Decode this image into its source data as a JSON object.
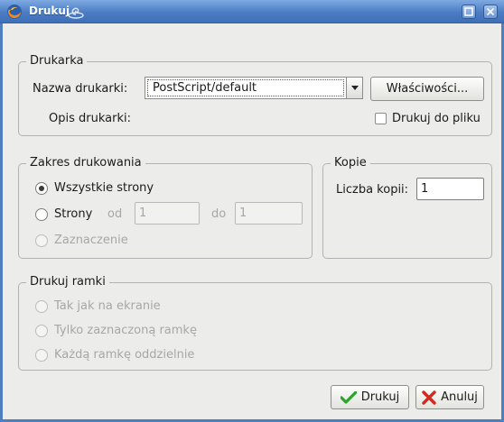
{
  "window": {
    "title": "Drukuj"
  },
  "printer": {
    "group_title": "Drukarka",
    "name_label": "Nazwa drukarki:",
    "selected_printer": "PostScript/default",
    "properties_button": "Właściwości...",
    "description_label": "Opis drukarki:",
    "print_to_file_label": "Drukuj do pliku",
    "print_to_file_checked": false
  },
  "range": {
    "group_title": "Zakres drukowania",
    "all_pages": "Wszystkie strony",
    "pages": "Strony",
    "from_label": "od",
    "from_value": "1",
    "to_label": "do",
    "to_value": "1",
    "selection": "Zaznaczenie"
  },
  "copies": {
    "group_title": "Kopie",
    "count_label": "Liczba kopii:",
    "count_value": "1"
  },
  "frames": {
    "group_title": "Drukuj ramki",
    "as_on_screen": "Tak jak na ekranie",
    "selected_frame": "Tylko zaznaczoną ramkę",
    "each_frame": "Każdą ramkę oddzielnie"
  },
  "actions": {
    "print_button": "Drukuj",
    "cancel_button": "Anuluj"
  },
  "colors": {
    "titlebar": "#4b7cc4",
    "print_icon": "#2aa52a",
    "cancel_icon": "#d22a1e"
  },
  "icons": [
    "firefox-icon",
    "spiral-icon",
    "maximize-icon",
    "close-icon",
    "dropdown-arrow-icon",
    "checkmark-icon",
    "cross-icon"
  ]
}
